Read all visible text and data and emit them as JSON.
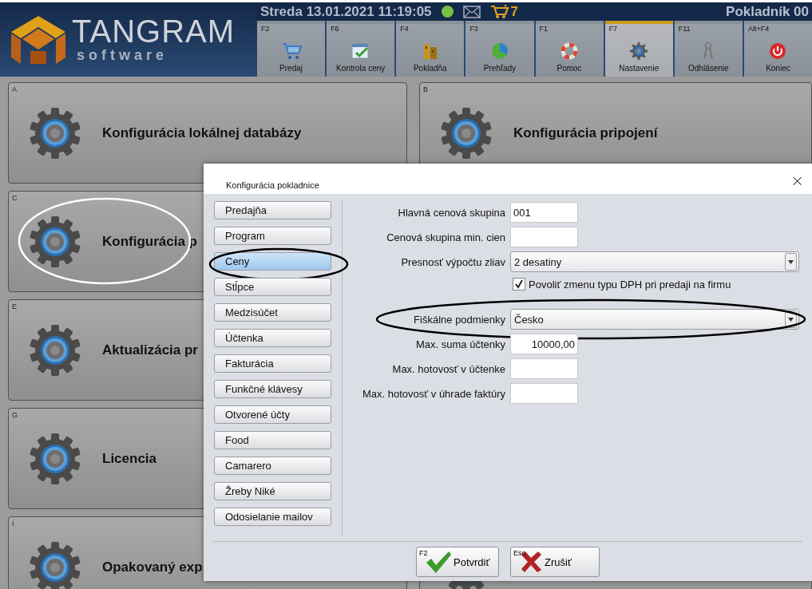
{
  "header": {
    "logo": {
      "name": "TANGRAM",
      "tagline": "software"
    },
    "datetime": "Streda 13.01.2021 11:19:05",
    "online": true,
    "cart_count": "7",
    "user": "Pokladník 00",
    "toolbar": [
      {
        "key": "F2",
        "label": "Predaj",
        "selected": false
      },
      {
        "key": "F6",
        "label": "Kontrola ceny",
        "selected": false
      },
      {
        "key": "F4",
        "label": "Pokladňa",
        "selected": false
      },
      {
        "key": "F3",
        "label": "Prehľady",
        "selected": false
      },
      {
        "key": "F1",
        "label": "Pomoc",
        "selected": false
      },
      {
        "key": "F7",
        "label": "Nastavenie",
        "selected": true
      },
      {
        "key": "F11",
        "label": "Odhlásenie",
        "selected": false
      },
      {
        "key": "Alt+F4",
        "label": "Koniec",
        "selected": false
      }
    ]
  },
  "tiles_left": [
    {
      "letter": "A",
      "title": "Konfigurácia lokálnej databázy",
      "circled": false
    },
    {
      "letter": "C",
      "title": "Konfigurácia p",
      "circled": true
    },
    {
      "letter": "E",
      "title": "Aktualizácia pr",
      "circled": false
    },
    {
      "letter": "G",
      "title": "Licencia",
      "circled": false
    },
    {
      "letter": "I",
      "title": "Opakovaný exp",
      "circled": false
    }
  ],
  "tiles_right": [
    {
      "letter": "B",
      "title": "Konfigurácia pripojení",
      "circled": false
    }
  ],
  "dialog": {
    "title": "Konfigurácia pokladnice",
    "close": "×",
    "nav": [
      {
        "label": "Predajňa",
        "selected": false,
        "circled": false
      },
      {
        "label": "Program",
        "selected": false,
        "circled": false
      },
      {
        "label": "Ceny",
        "selected": true,
        "circled": true
      },
      {
        "label": "Stĺpce",
        "selected": false,
        "circled": false
      },
      {
        "label": "Medzisúčet",
        "selected": false,
        "circled": false
      },
      {
        "label": "Účtenka",
        "selected": false,
        "circled": false
      },
      {
        "label": "Fakturácia",
        "selected": false,
        "circled": false
      },
      {
        "label": "Funkčné klávesy",
        "selected": false,
        "circled": false
      },
      {
        "label": "Otvorené účty",
        "selected": false,
        "circled": false
      },
      {
        "label": "Food",
        "selected": false,
        "circled": false
      },
      {
        "label": "Camarero",
        "selected": false,
        "circled": false
      },
      {
        "label": "Žreby Niké",
        "selected": false,
        "circled": false
      },
      {
        "label": "Odosielanie mailov",
        "selected": false,
        "circled": false
      }
    ],
    "fields": [
      {
        "kind": "text",
        "label": "Hlavná cenová skupina",
        "value": "001",
        "circled": false
      },
      {
        "kind": "text",
        "label": "Cenová skupina min. cien",
        "circled": false
      },
      {
        "kind": "select",
        "label": "Presnosť výpočtu zliav",
        "value": "2 desatiny",
        "circled": false
      },
      {
        "kind": "checkbox",
        "label": "Povoliť zmenu typu DPH pri predaji na firmu",
        "checked": true,
        "circled": false
      },
      {
        "kind": "select",
        "label": "Fiškálne podmienky",
        "value": "Česko",
        "circled": true
      },
      {
        "kind": "number",
        "label": "Max. suma účtenky",
        "value": "10000,00",
        "circled": false
      },
      {
        "kind": "text",
        "label": "Max. hotovosť v účtenke",
        "circled": false
      },
      {
        "kind": "text",
        "label": "Max. hotovosť v úhrade faktúry",
        "circled": false
      }
    ],
    "buttons": [
      {
        "kind": "confirm",
        "key": "F2",
        "label": "Potvrdiť"
      },
      {
        "kind": "cancel",
        "key": "Esc",
        "label": "Zrušiť"
      }
    ]
  }
}
